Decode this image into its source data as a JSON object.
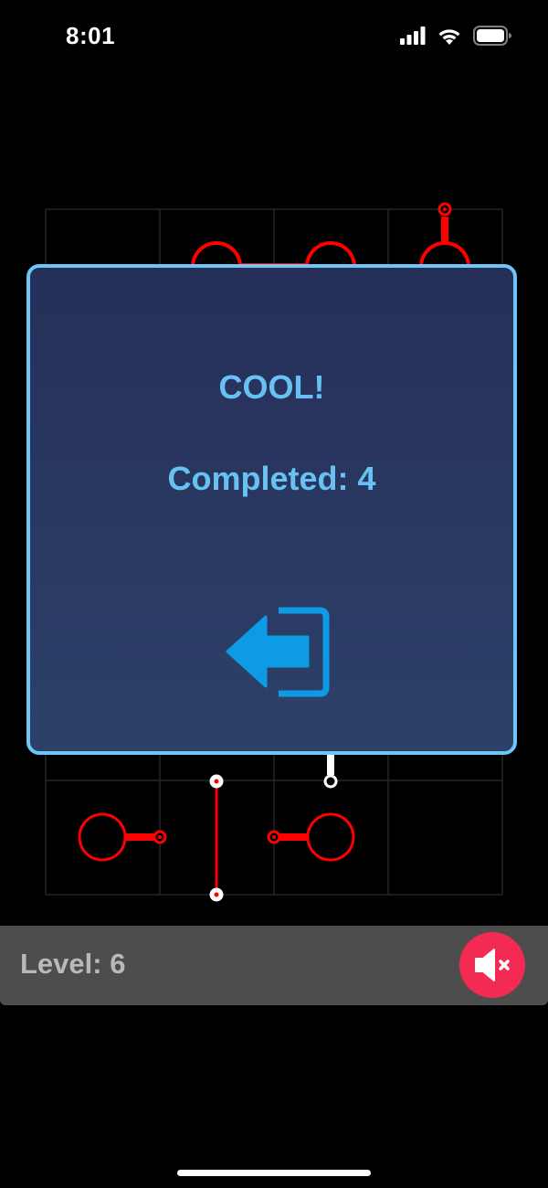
{
  "status_bar": {
    "time": "8:01",
    "icons": [
      "cellular-signal-icon",
      "wifi-icon",
      "battery-icon"
    ]
  },
  "board": {
    "grid_columns": 4,
    "grid_rows": 6,
    "wire_color": "#ff0000",
    "powered_color": "#ffffff",
    "grid_line_color": "#262626"
  },
  "modal": {
    "title": "COOL!",
    "completed": "Completed: 4",
    "exit_icon": "exit-arrow-icon",
    "accent_color": "#6ec6f5",
    "icon_color": "#0d9be6"
  },
  "bottom_bar": {
    "level": "Level: 6",
    "mute_icon": "speaker-muted-icon",
    "mute_color": "#f32a52"
  }
}
